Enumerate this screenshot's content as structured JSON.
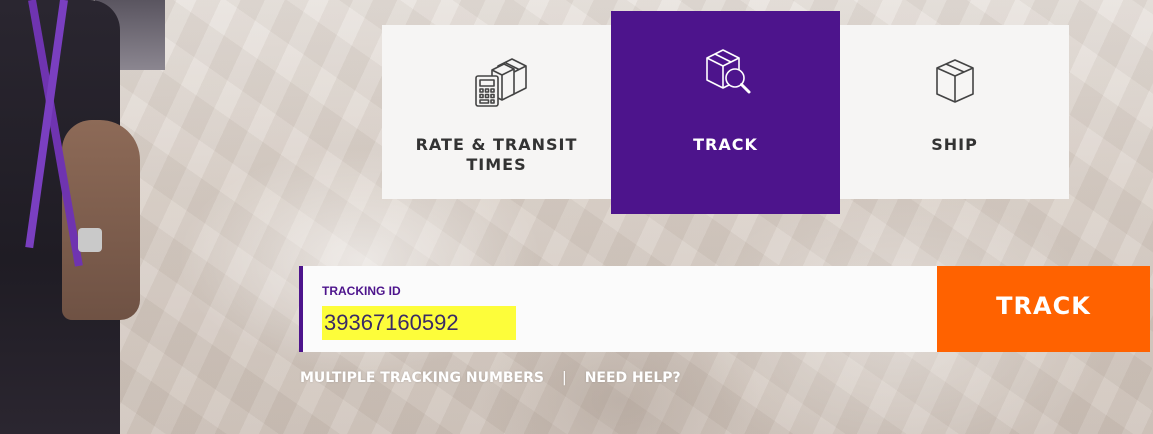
{
  "tabs": [
    {
      "id": "rate",
      "label": "RATE & TRANSIT\nTIMES",
      "icon": "calculator-box-icon",
      "active": false
    },
    {
      "id": "track",
      "label": "TRACK",
      "icon": "box-magnifier-icon",
      "active": true
    },
    {
      "id": "ship",
      "label": "SHIP",
      "icon": "box-icon",
      "active": false
    }
  ],
  "tracking": {
    "label": "TRACKING ID",
    "value": "39367160592",
    "button_label": "TRACK"
  },
  "links": {
    "multiple": "MULTIPLE TRACKING NUMBERS",
    "separator": "|",
    "help": "NEED HELP?"
  },
  "colors": {
    "brand_purple": "#4d148c",
    "brand_orange": "#ff6200",
    "highlight": "#fdfd3a"
  }
}
